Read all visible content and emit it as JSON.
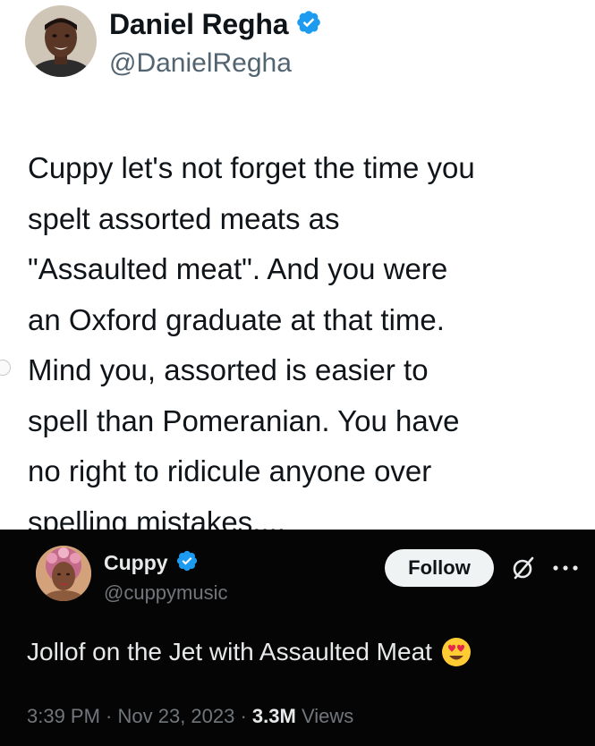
{
  "top_tweet": {
    "author_name": "Daniel Regha",
    "author_handle": "@DanielRegha",
    "text": "Cuppy let's not forget the time you\nspelt assorted meats as\n\"Assaulted meat\". And you were\nan Oxford graduate at that time.\nMind you, assorted is easier to\nspell than Pomeranian. You have\nno right to ridicule anyone over\nspelling mistakes....",
    "verified_color": "#1d9bf0"
  },
  "quoted_tweet": {
    "author_name": "Cuppy",
    "author_handle": "@cuppymusic",
    "follow_label": "Follow",
    "text": "Jollof on the Jet with Assaulted Meat",
    "emoji": "heart-eyes-emoji",
    "timestamp": "3:39 PM · Nov 23, 2023 · ",
    "views_count": "3.3M",
    "views_label": "Views",
    "background": "#050505"
  },
  "icons": {
    "verified": "verified-badge-icon",
    "grok": "grok-icon",
    "more": "more-options-icon"
  }
}
